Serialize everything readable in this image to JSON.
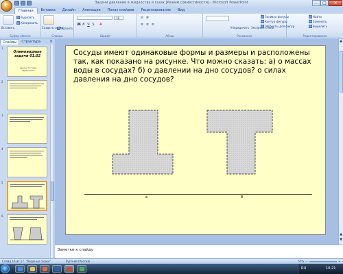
{
  "window": {
    "title": "Задачи давление в жидкостях и газах [Режим совместимости] - Microsoft PowerPoint"
  },
  "ribbon": {
    "tabs": [
      "Главная",
      "Вставка",
      "Дизайн",
      "Анимация",
      "Показ слайдов",
      "Рецензирование",
      "Вид"
    ],
    "active_tab": "Главная",
    "paste_label": "Вставить",
    "create_slide_label": "Создать слайд",
    "cut_label": "Вырезать",
    "copy_label": "Копировать",
    "delete_label": "Удалить",
    "arrange_label": "Упорядочить",
    "express_styles_label": "Экспресс-стили",
    "fill_label": "Заливка фигуры",
    "outline_label": "Контур фигуры",
    "effects_label": "Эффекты для фигур",
    "find_label": "Найти",
    "replace_label": "Заменить",
    "select_label": "Выделить",
    "font_size": "18",
    "language": "Русский",
    "groups": [
      "Буфер обмена",
      "Слайды",
      "Шрифт",
      "Абзац",
      "Рисование",
      "Редактирование"
    ]
  },
  "panel": {
    "tabs": [
      "Слайды",
      "Структура"
    ],
    "active_tab": "Слайды",
    "close_symbol": "×",
    "slide_numbers": [
      "1",
      "2",
      "3",
      "4",
      "5",
      "6"
    ],
    "title_slide": {
      "title": "Олимпиадные задачи 01.02",
      "subtitle": "задачи по теме «Давление»"
    }
  },
  "slide": {
    "question": "Сосуды имеют одинаковые формы и размеры и расположены так, как показано на рисунке. Что можно сказать: а) о массах воды в сосудах? б) о давлении на дно сосудов? о силах давления на дно сосудов?",
    "label_a": "а",
    "label_b": "б"
  },
  "notes": {
    "placeholder": "Заметки к слайду"
  },
  "status": {
    "slide_info": "Слайд 16 из 17",
    "theme": "\"Водяные знаки\"",
    "language": "Русский (Россия)",
    "zoom": "55%"
  },
  "taskbar": {
    "lang": "RU",
    "time": "10:21"
  },
  "colors": {
    "slide_bg": "#ffffc8",
    "vessel_fill": "#d9d9d9",
    "ribbon_accent": "#15428b"
  }
}
